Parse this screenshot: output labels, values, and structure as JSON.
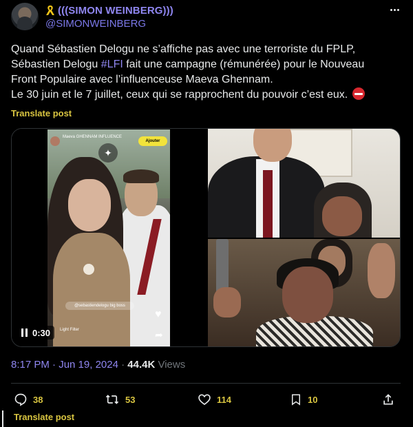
{
  "author": {
    "display_name": "(((SIMON WEINBERG)))",
    "handle": "@SIMONWEINBERG",
    "badge_icon": "yellow-ribbon-icon"
  },
  "tweet": {
    "lines": [
      "Quand Sébastien Delogu ne s’affiche pas avec une terroriste du FPLP,",
      "Sébastien Delogu ",
      "#LFI",
      " fait une campagne (rémunérée) pour le Nouveau",
      "Front Populaire avec l’influenceuse Maeva Ghennam.",
      "Le 30 juin et le 7 juillet, ceux qui se rapprochent du pouvoir c’est eux."
    ],
    "emoji": "no-entry-icon"
  },
  "translate_label": "Translate post",
  "media": {
    "video_time": "0:30",
    "video_follow_label": "Ajouter",
    "video_caption": "@sebastiendelogu big boss",
    "video_filter_label": "Light Filter",
    "video_channel": "Maeva GHENNAM INFLUENCE"
  },
  "meta": {
    "time": "8:17 PM · Jun 19, 2024",
    "separator": " · ",
    "views_count": "44.4K",
    "views_label": " Views"
  },
  "actions": {
    "replies": "38",
    "reposts": "53",
    "likes": "114",
    "bookmarks": "10"
  },
  "colors": {
    "accent_name": "#8f86f0",
    "action_yellow": "#d9c541",
    "background": "#000000"
  }
}
